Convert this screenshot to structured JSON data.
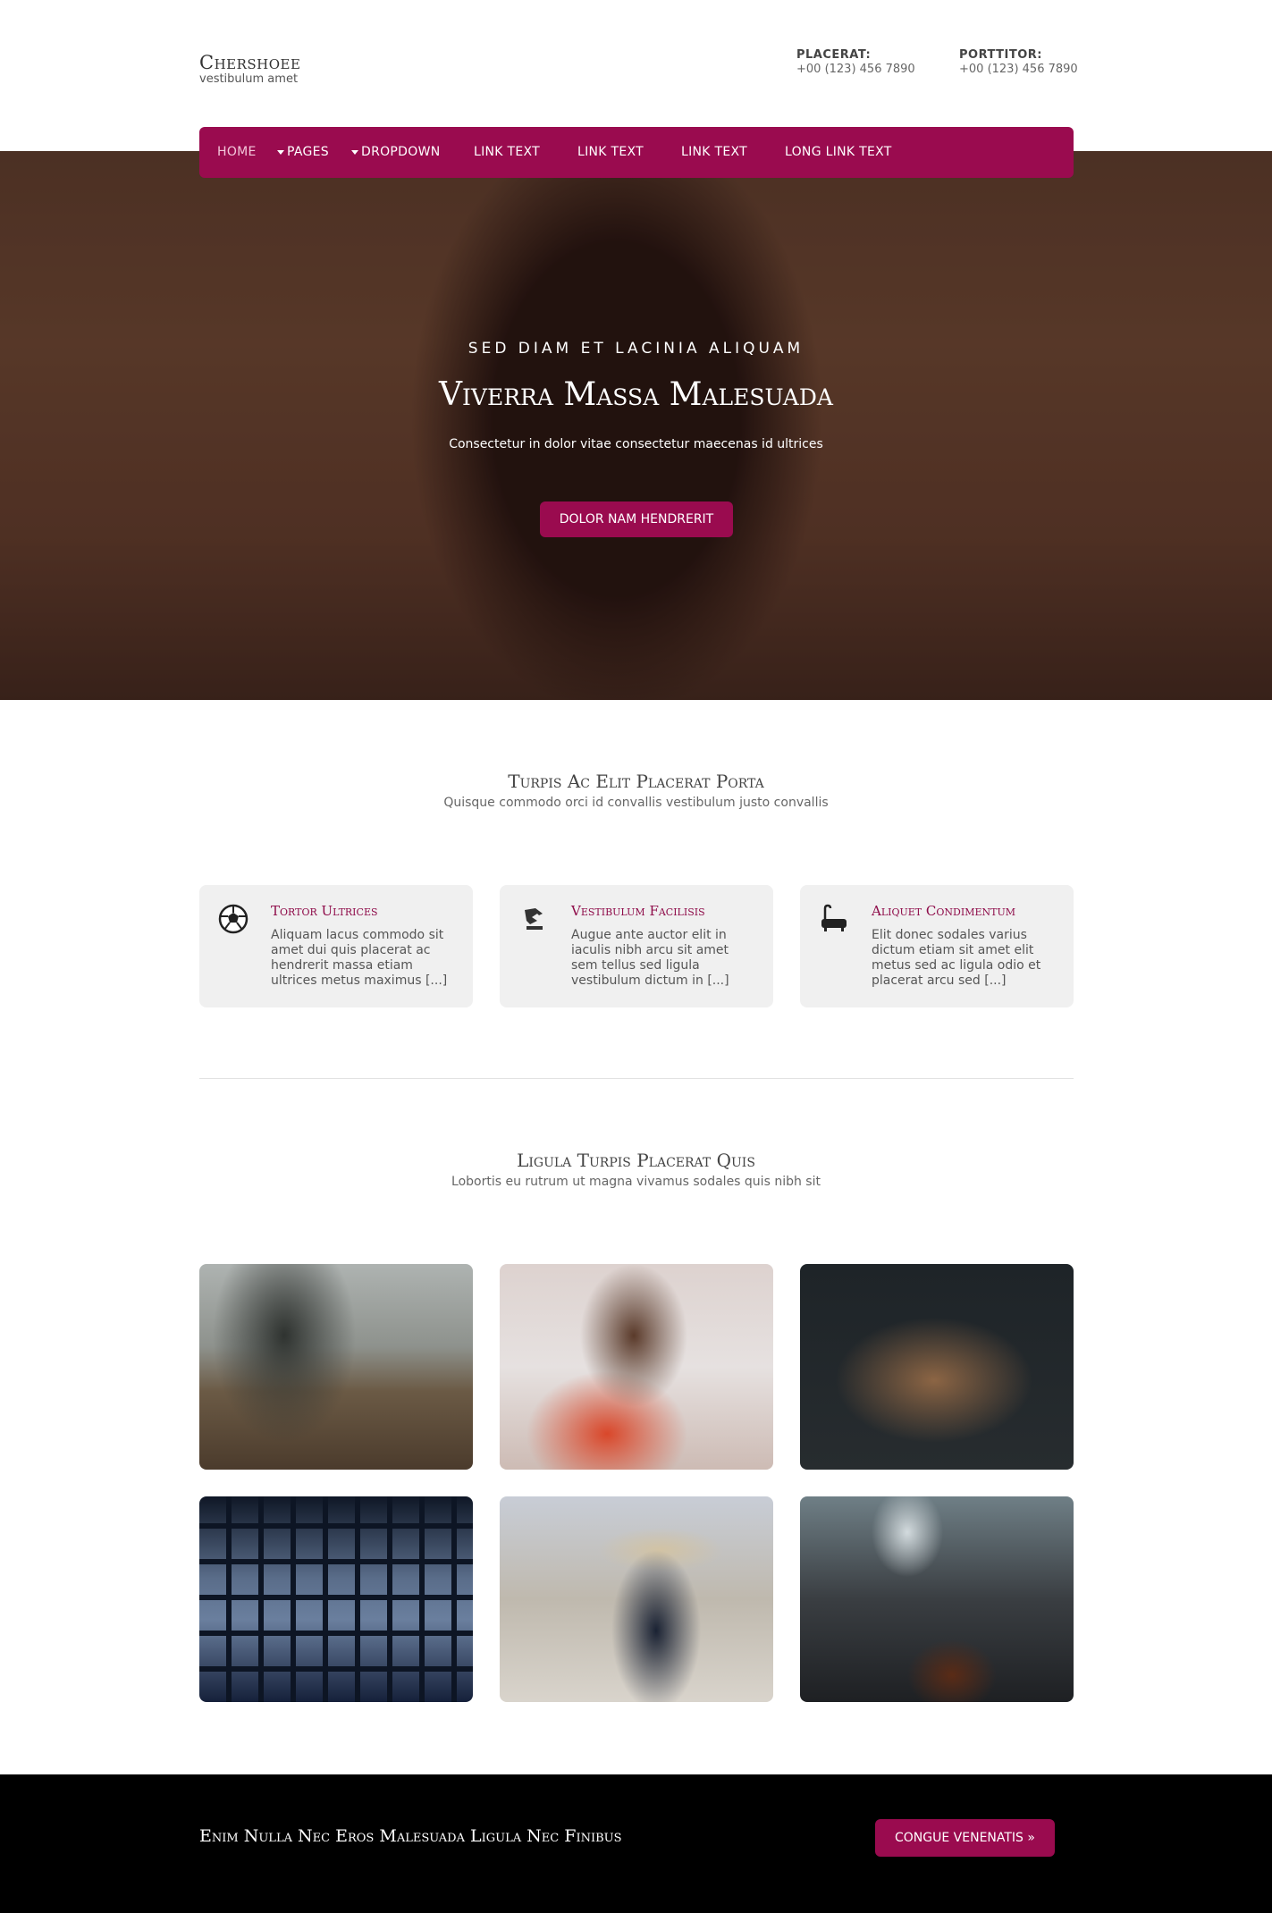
{
  "header": {
    "logo_title": "Chershoee",
    "logo_subtitle": "vestibulum amet",
    "contacts": [
      {
        "label": "PLACERAT:",
        "value": "+00 (123) 456 7890"
      },
      {
        "label": "PORTTITOR:",
        "value": "+00 (123) 456 7890"
      }
    ]
  },
  "nav": {
    "items": [
      {
        "label": "HOME",
        "active": true
      },
      {
        "label": "PAGES",
        "dropdown": true
      },
      {
        "label": "DROPDOWN",
        "dropdown": true
      },
      {
        "label": "LINK TEXT"
      },
      {
        "label": "LINK TEXT"
      },
      {
        "label": "LINK TEXT"
      },
      {
        "label": "LONG LINK TEXT"
      }
    ]
  },
  "hero": {
    "kicker": "SED DIAM ET LACINIA ALIQUAM",
    "title": "Viverra Massa Malesuada",
    "subtitle": "Consectetur in dolor vitae consectetur maecenas id ultrices",
    "button_label": "DOLOR NAM HENDRERIT"
  },
  "features": {
    "title": "Turpis Ac Elit Placerat Porta",
    "subtitle": "Quisque commodo orci id convallis vestibulum justo convallis",
    "cards": [
      {
        "icon": "soccer-ball-icon",
        "title": "Tortor Ultrices",
        "text": "Aliquam lacus commodo sit amet dui quis placerat ac hendrerit massa etiam ultrices metus maximus [...]"
      },
      {
        "icon": "chess-knight-icon",
        "title": "Vestibulum Facilisis",
        "text": "Augue ante auctor elit in iaculis nibh arcu sit amet sem tellus sed ligula vestibulum dictum in [...]"
      },
      {
        "icon": "bathtub-icon",
        "title": "Aliquet Condimentum",
        "text": "Elit donec sodales varius dictum etiam sit amet elit metus sed ac ligula odio et placerat arcu sed [...]"
      }
    ]
  },
  "gallery": {
    "title": "Ligula Turpis Placerat Quis",
    "subtitle": "Lobortis eu rutrum ut magna vivamus sodales quis nibh sit"
  },
  "footer": {
    "text": "Enim Nulla Nec Eros Malesuada Ligula Nec Finibus",
    "button_label": "CONGUE VENENATIS »"
  },
  "colors": {
    "accent": "#9a0b4f",
    "card_title": "#8e0b49",
    "footer_bg": "#000000"
  }
}
